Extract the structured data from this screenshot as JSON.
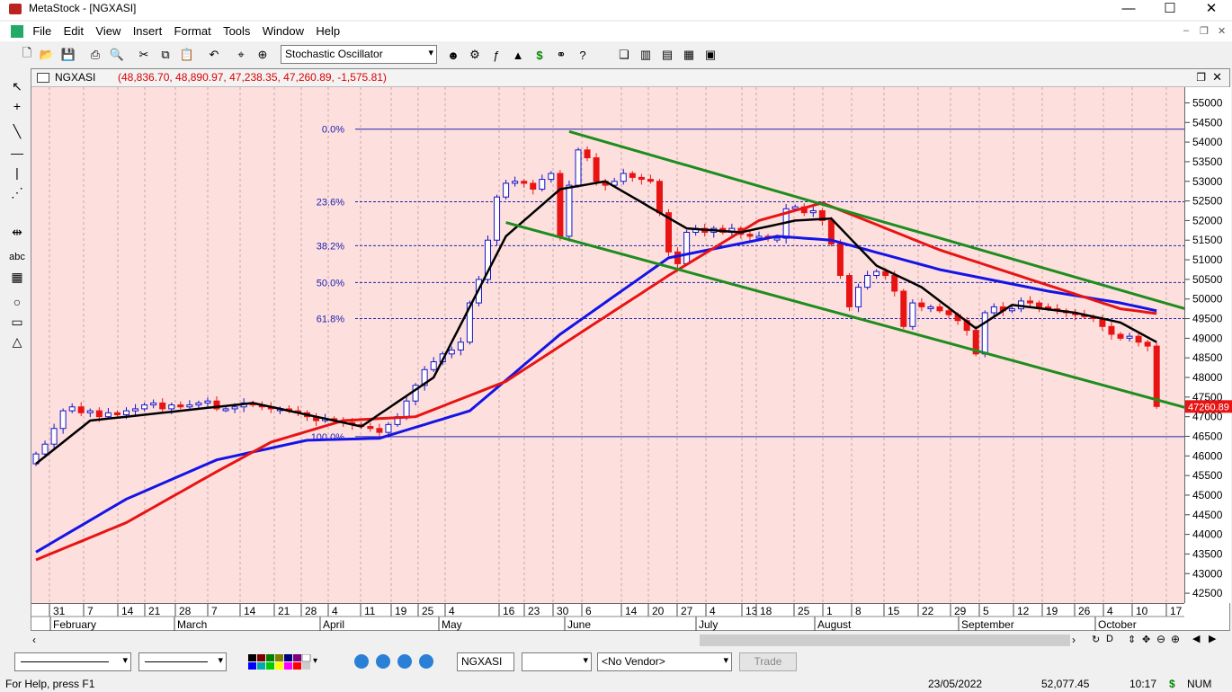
{
  "window": {
    "title": "MetaStock - [NGXASI]",
    "min": "—",
    "max": "☐",
    "close": "✕"
  },
  "menu": [
    "File",
    "Edit",
    "View",
    "Insert",
    "Format",
    "Tools",
    "Window",
    "Help"
  ],
  "toolbar": {
    "indicator_select": "Stochastic Oscillator"
  },
  "chart": {
    "symbol": "NGXASI",
    "ohlc": "(48,836.70, 48,890.97, 47,238.35, 47,260.89, -1,575.81)",
    "last_price_label": "47260.89",
    "fib_levels": [
      {
        "label": "0.0%",
        "price": 54330
      },
      {
        "label": "23.6%",
        "price": 52480
      },
      {
        "label": "38.2%",
        "price": 51360
      },
      {
        "label": "50.0%",
        "price": 50420
      },
      {
        "label": "61.8%",
        "price": 49500
      },
      {
        "label": "100.0%",
        "price": 46490
      }
    ],
    "y_ticks": [
      55000,
      54500,
      54000,
      53500,
      53000,
      52500,
      52000,
      51500,
      51000,
      50500,
      50000,
      49500,
      49000,
      48500,
      48000,
      47500,
      47000,
      46500,
      46000,
      45500,
      45000,
      44500,
      44000,
      43500,
      43000,
      42500
    ],
    "x_days": [
      "31",
      "7",
      "14",
      "21",
      "28",
      "7",
      "14",
      "21",
      "28",
      "4",
      "11",
      "19",
      "25",
      "4",
      "16",
      "23",
      "30",
      "6",
      "14",
      "20",
      "27",
      "4",
      "13",
      "18",
      "25",
      "1",
      "8",
      "15",
      "22",
      "29",
      "5",
      "12",
      "19",
      "26",
      "4",
      "10",
      "17"
    ],
    "x_months": [
      "February",
      "March",
      "April",
      "May",
      "June",
      "July",
      "August",
      "September",
      "October"
    ],
    "colors": {
      "background": "#fde0de",
      "bull": "#1414c8",
      "bear": "#e81414",
      "ma_fast": "#000000",
      "ma_mid": "#e81414",
      "ma_slow": "#1414e6",
      "channel": "#1f8c1f",
      "fib": "#2020b0"
    }
  },
  "chart_data": {
    "type": "candlestick",
    "y_range": [
      42250,
      55400
    ],
    "candles_close": [
      46050,
      46300,
      46700,
      47150,
      47250,
      47100,
      47150,
      47000,
      47100,
      47050,
      47150,
      47200,
      47300,
      47350,
      47200,
      47300,
      47250,
      47300,
      47350,
      47400,
      47200,
      47200,
      47250,
      47350,
      47300,
      47250,
      47200,
      47200,
      47150,
      47100,
      47000,
      46900,
      46950,
      46900,
      46850,
      46800,
      46750,
      46700,
      46600,
      46800,
      47000,
      47400,
      47800,
      48200,
      48400,
      48600,
      48700,
      48900,
      49900,
      50500,
      51500,
      52600,
      52950,
      53000,
      52950,
      52800,
      53050,
      53200,
      51600,
      52900,
      53800,
      53600,
      53000,
      52900,
      53000,
      53200,
      53100,
      53050,
      53000,
      52200,
      51200,
      50900,
      51700,
      51800,
      51700,
      51800,
      51700,
      51800,
      51650,
      51600,
      51600,
      51550,
      51550,
      52300,
      52350,
      52200,
      52250,
      52000,
      51400,
      50600,
      49800,
      50300,
      50600,
      50700,
      50600,
      50200,
      49300,
      49900,
      49800,
      49800,
      49700,
      49600,
      49450,
      49200,
      48600,
      49650,
      49800,
      49700,
      49750,
      49950,
      49900,
      49800,
      49750,
      49700,
      49650,
      49600,
      49550,
      49500,
      49300,
      49100,
      49000,
      49050,
      48900,
      48800,
      47260
    ],
    "ma_fast_anchors": [
      [
        0,
        45800
      ],
      [
        6,
        46900
      ],
      [
        12,
        47050
      ],
      [
        24,
        47350
      ],
      [
        36,
        46750
      ],
      [
        44,
        48000
      ],
      [
        52,
        51600
      ],
      [
        58,
        52800
      ],
      [
        63,
        53000
      ],
      [
        72,
        51800
      ],
      [
        78,
        51700
      ],
      [
        84,
        52000
      ],
      [
        88,
        52050
      ],
      [
        93,
        50850
      ],
      [
        98,
        50300
      ],
      [
        104,
        49250
      ],
      [
        108,
        49850
      ],
      [
        115,
        49650
      ],
      [
        120,
        49400
      ],
      [
        124,
        48900
      ]
    ],
    "ma_mid_anchors": [
      [
        0,
        43350
      ],
      [
        10,
        44300
      ],
      [
        20,
        45600
      ],
      [
        26,
        46350
      ],
      [
        34,
        46900
      ],
      [
        42,
        47000
      ],
      [
        52,
        47900
      ],
      [
        58,
        48800
      ],
      [
        70,
        50600
      ],
      [
        80,
        52000
      ],
      [
        87,
        52450
      ],
      [
        100,
        51250
      ],
      [
        112,
        50350
      ],
      [
        120,
        49750
      ],
      [
        125,
        49600
      ]
    ],
    "ma_slow_anchors": [
      [
        0,
        43550
      ],
      [
        10,
        44900
      ],
      [
        20,
        45900
      ],
      [
        30,
        46400
      ],
      [
        38,
        46450
      ],
      [
        48,
        47150
      ],
      [
        58,
        49100
      ],
      [
        70,
        51050
      ],
      [
        82,
        51600
      ],
      [
        88,
        51500
      ],
      [
        100,
        50750
      ],
      [
        112,
        50200
      ],
      [
        120,
        49900
      ],
      [
        125,
        49650
      ]
    ],
    "channel_upper": [
      [
        59,
        54270
      ],
      [
        140,
        48900
      ]
    ],
    "channel_lower": [
      [
        52,
        51950
      ],
      [
        139,
        46490
      ]
    ]
  }
}
